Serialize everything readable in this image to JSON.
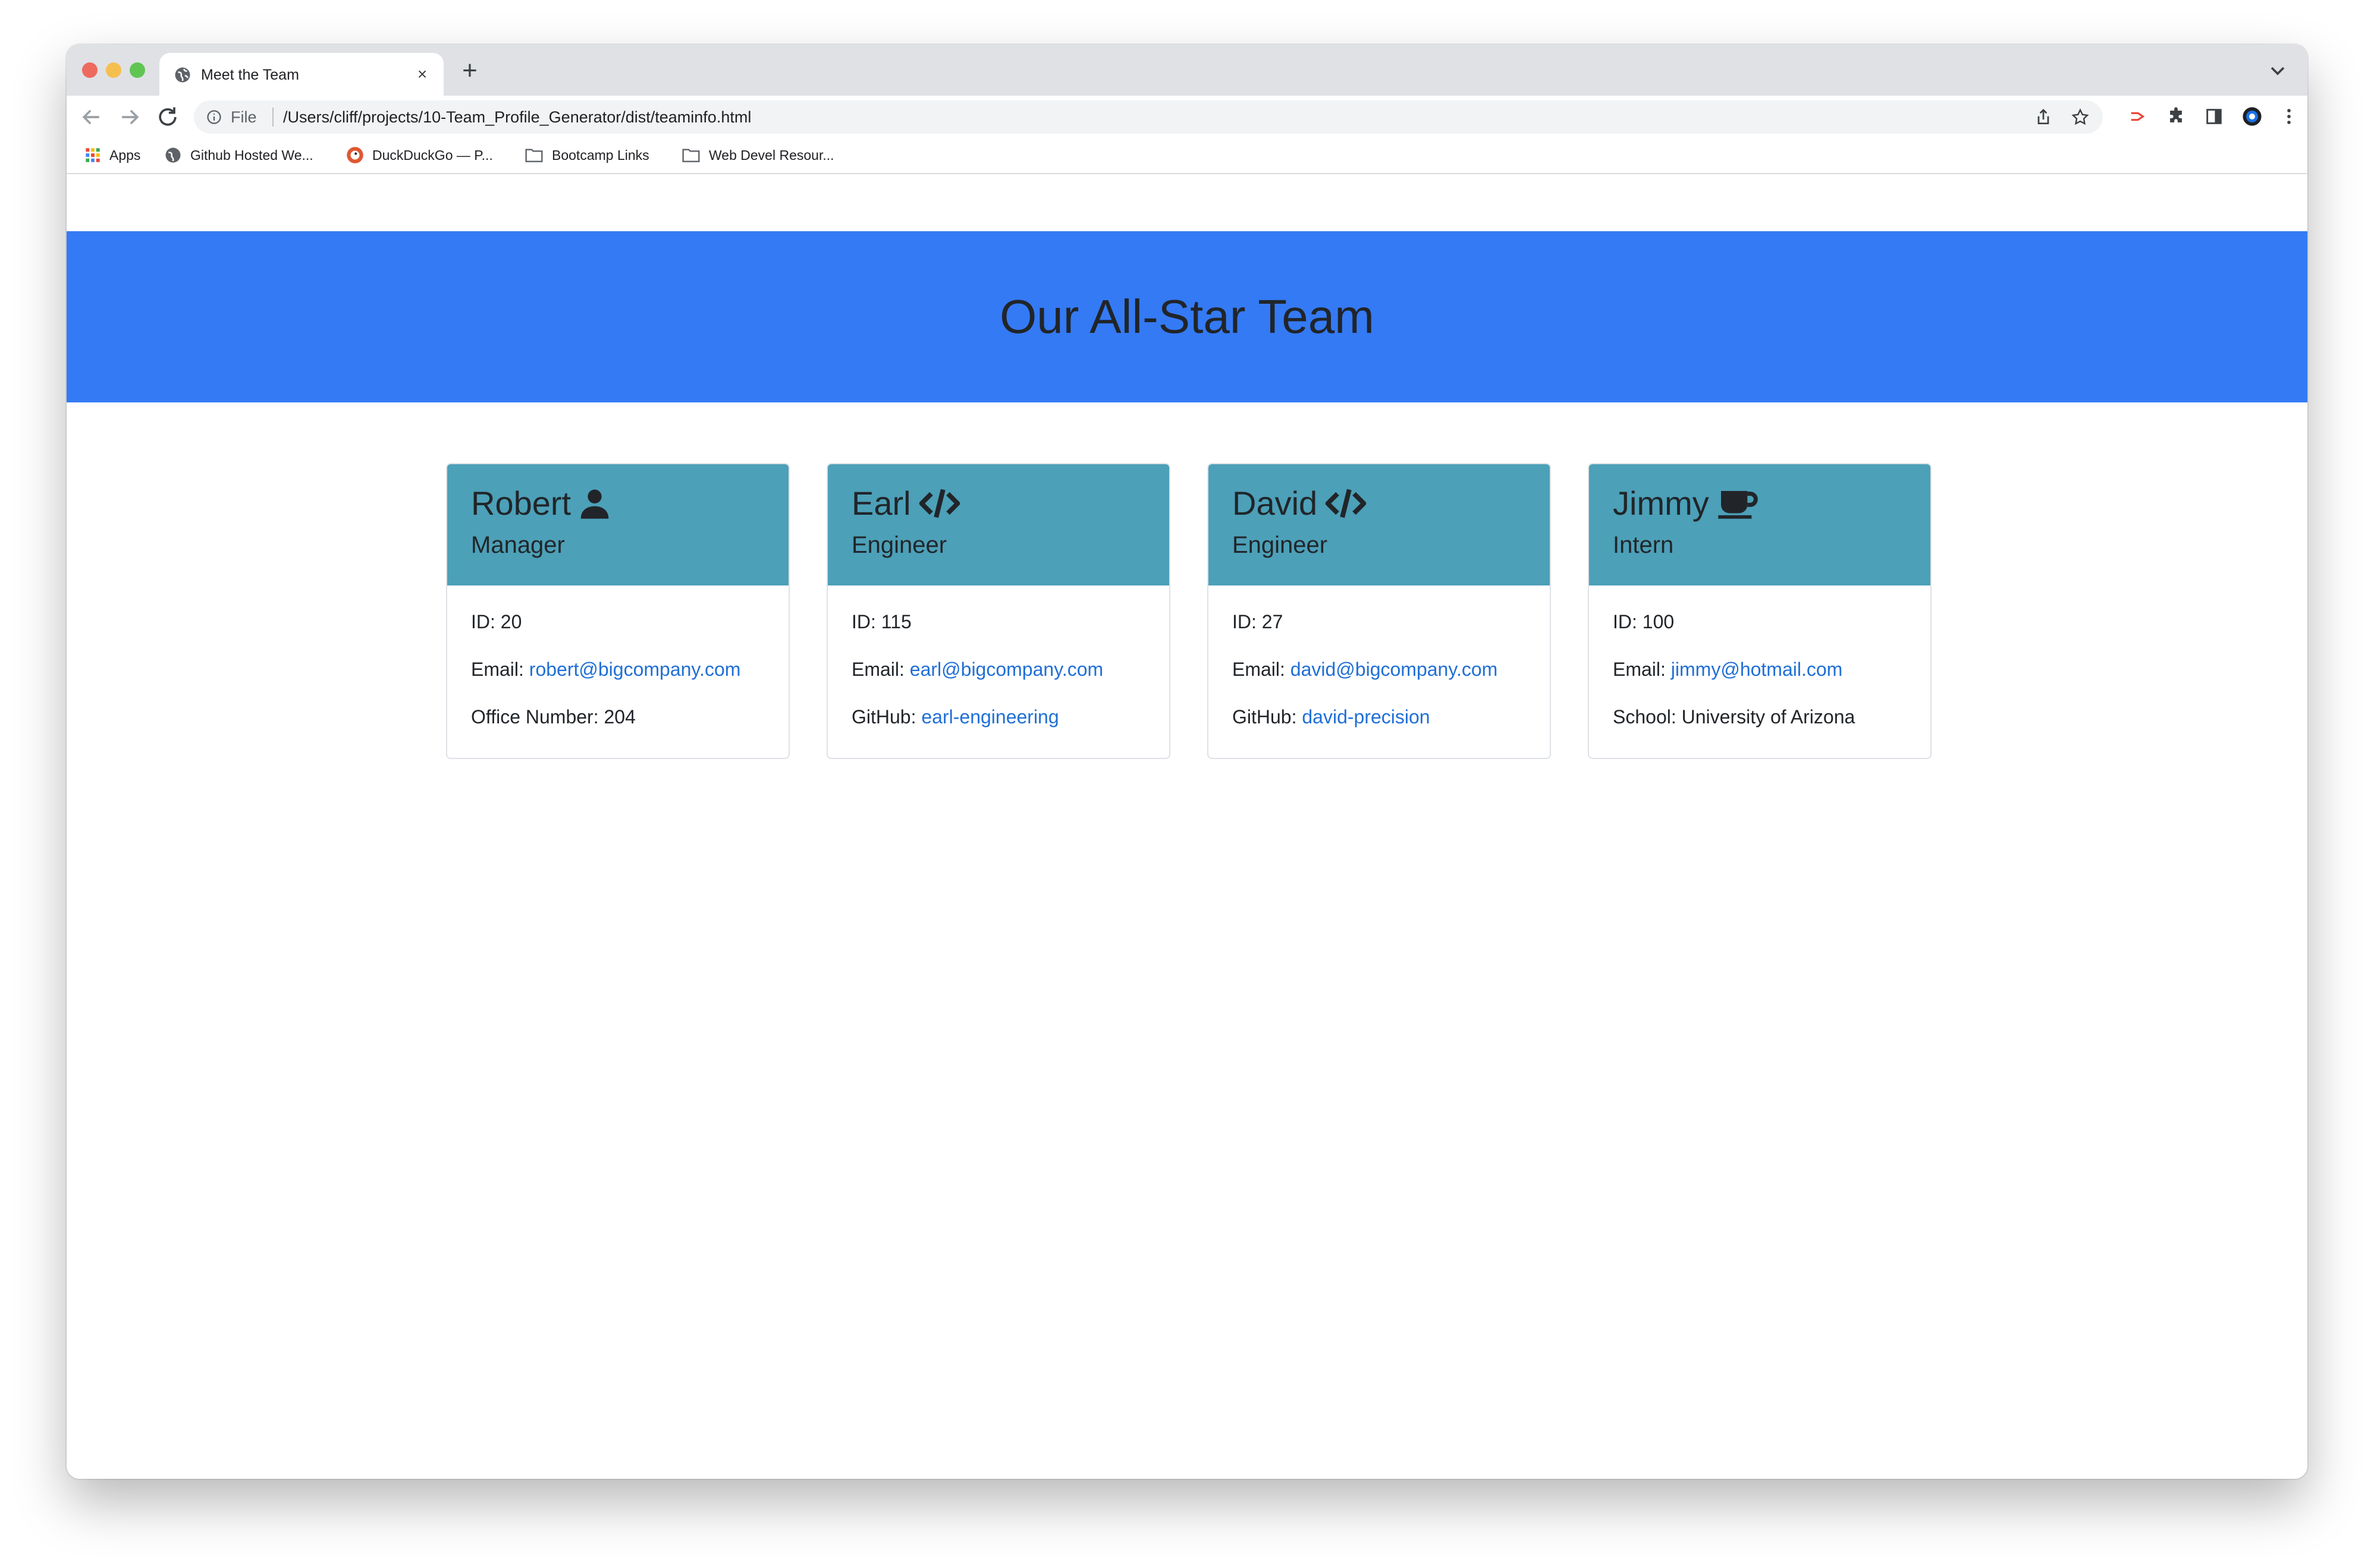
{
  "browser": {
    "tab_title": "Meet the Team",
    "new_tab": "+",
    "tab_close": "×",
    "file_label": "File",
    "url": "/Users/cliff/projects/10-Team_Profile_Generator/dist/teaminfo.html"
  },
  "bookmarks": [
    {
      "label": "Apps",
      "icon": "apps-grid-icon"
    },
    {
      "label": "Github Hosted We...",
      "icon": "globe-icon"
    },
    {
      "label": "DuckDuckGo — P...",
      "icon": "duckduckgo-icon"
    },
    {
      "label": "Bootcamp Links",
      "icon": "folder-icon"
    },
    {
      "label": "Web Devel Resour...",
      "icon": "folder-icon"
    }
  ],
  "page": {
    "title": "Our All-Star Team"
  },
  "colors": {
    "jumbotron": "#347af4",
    "card_header": "#4ca0b8",
    "link": "#1f6fd6"
  },
  "team": [
    {
      "name": "Robert",
      "role": "Manager",
      "icon": "user-icon",
      "id_label": "ID:",
      "id": "20",
      "email_label": "Email:",
      "email": "robert@bigcompany.com",
      "extra_label": "Office Number:",
      "extra": "204",
      "extra_is_link": false
    },
    {
      "name": "Earl",
      "role": "Engineer",
      "icon": "code-icon",
      "id_label": "ID:",
      "id": "115",
      "email_label": "Email:",
      "email": "earl@bigcompany.com",
      "extra_label": "GitHub:",
      "extra": "earl-engineering",
      "extra_is_link": true
    },
    {
      "name": "David",
      "role": "Engineer",
      "icon": "code-icon",
      "id_label": "ID:",
      "id": "27",
      "email_label": "Email:",
      "email": "david@bigcompany.com",
      "extra_label": "GitHub:",
      "extra": "david-precision",
      "extra_is_link": true
    },
    {
      "name": "Jimmy",
      "role": "Intern",
      "icon": "mug-icon",
      "id_label": "ID:",
      "id": "100",
      "email_label": "Email:",
      "email": "jimmy@hotmail.com",
      "extra_label": "School:",
      "extra": "University of Arizona",
      "extra_is_link": false
    }
  ]
}
